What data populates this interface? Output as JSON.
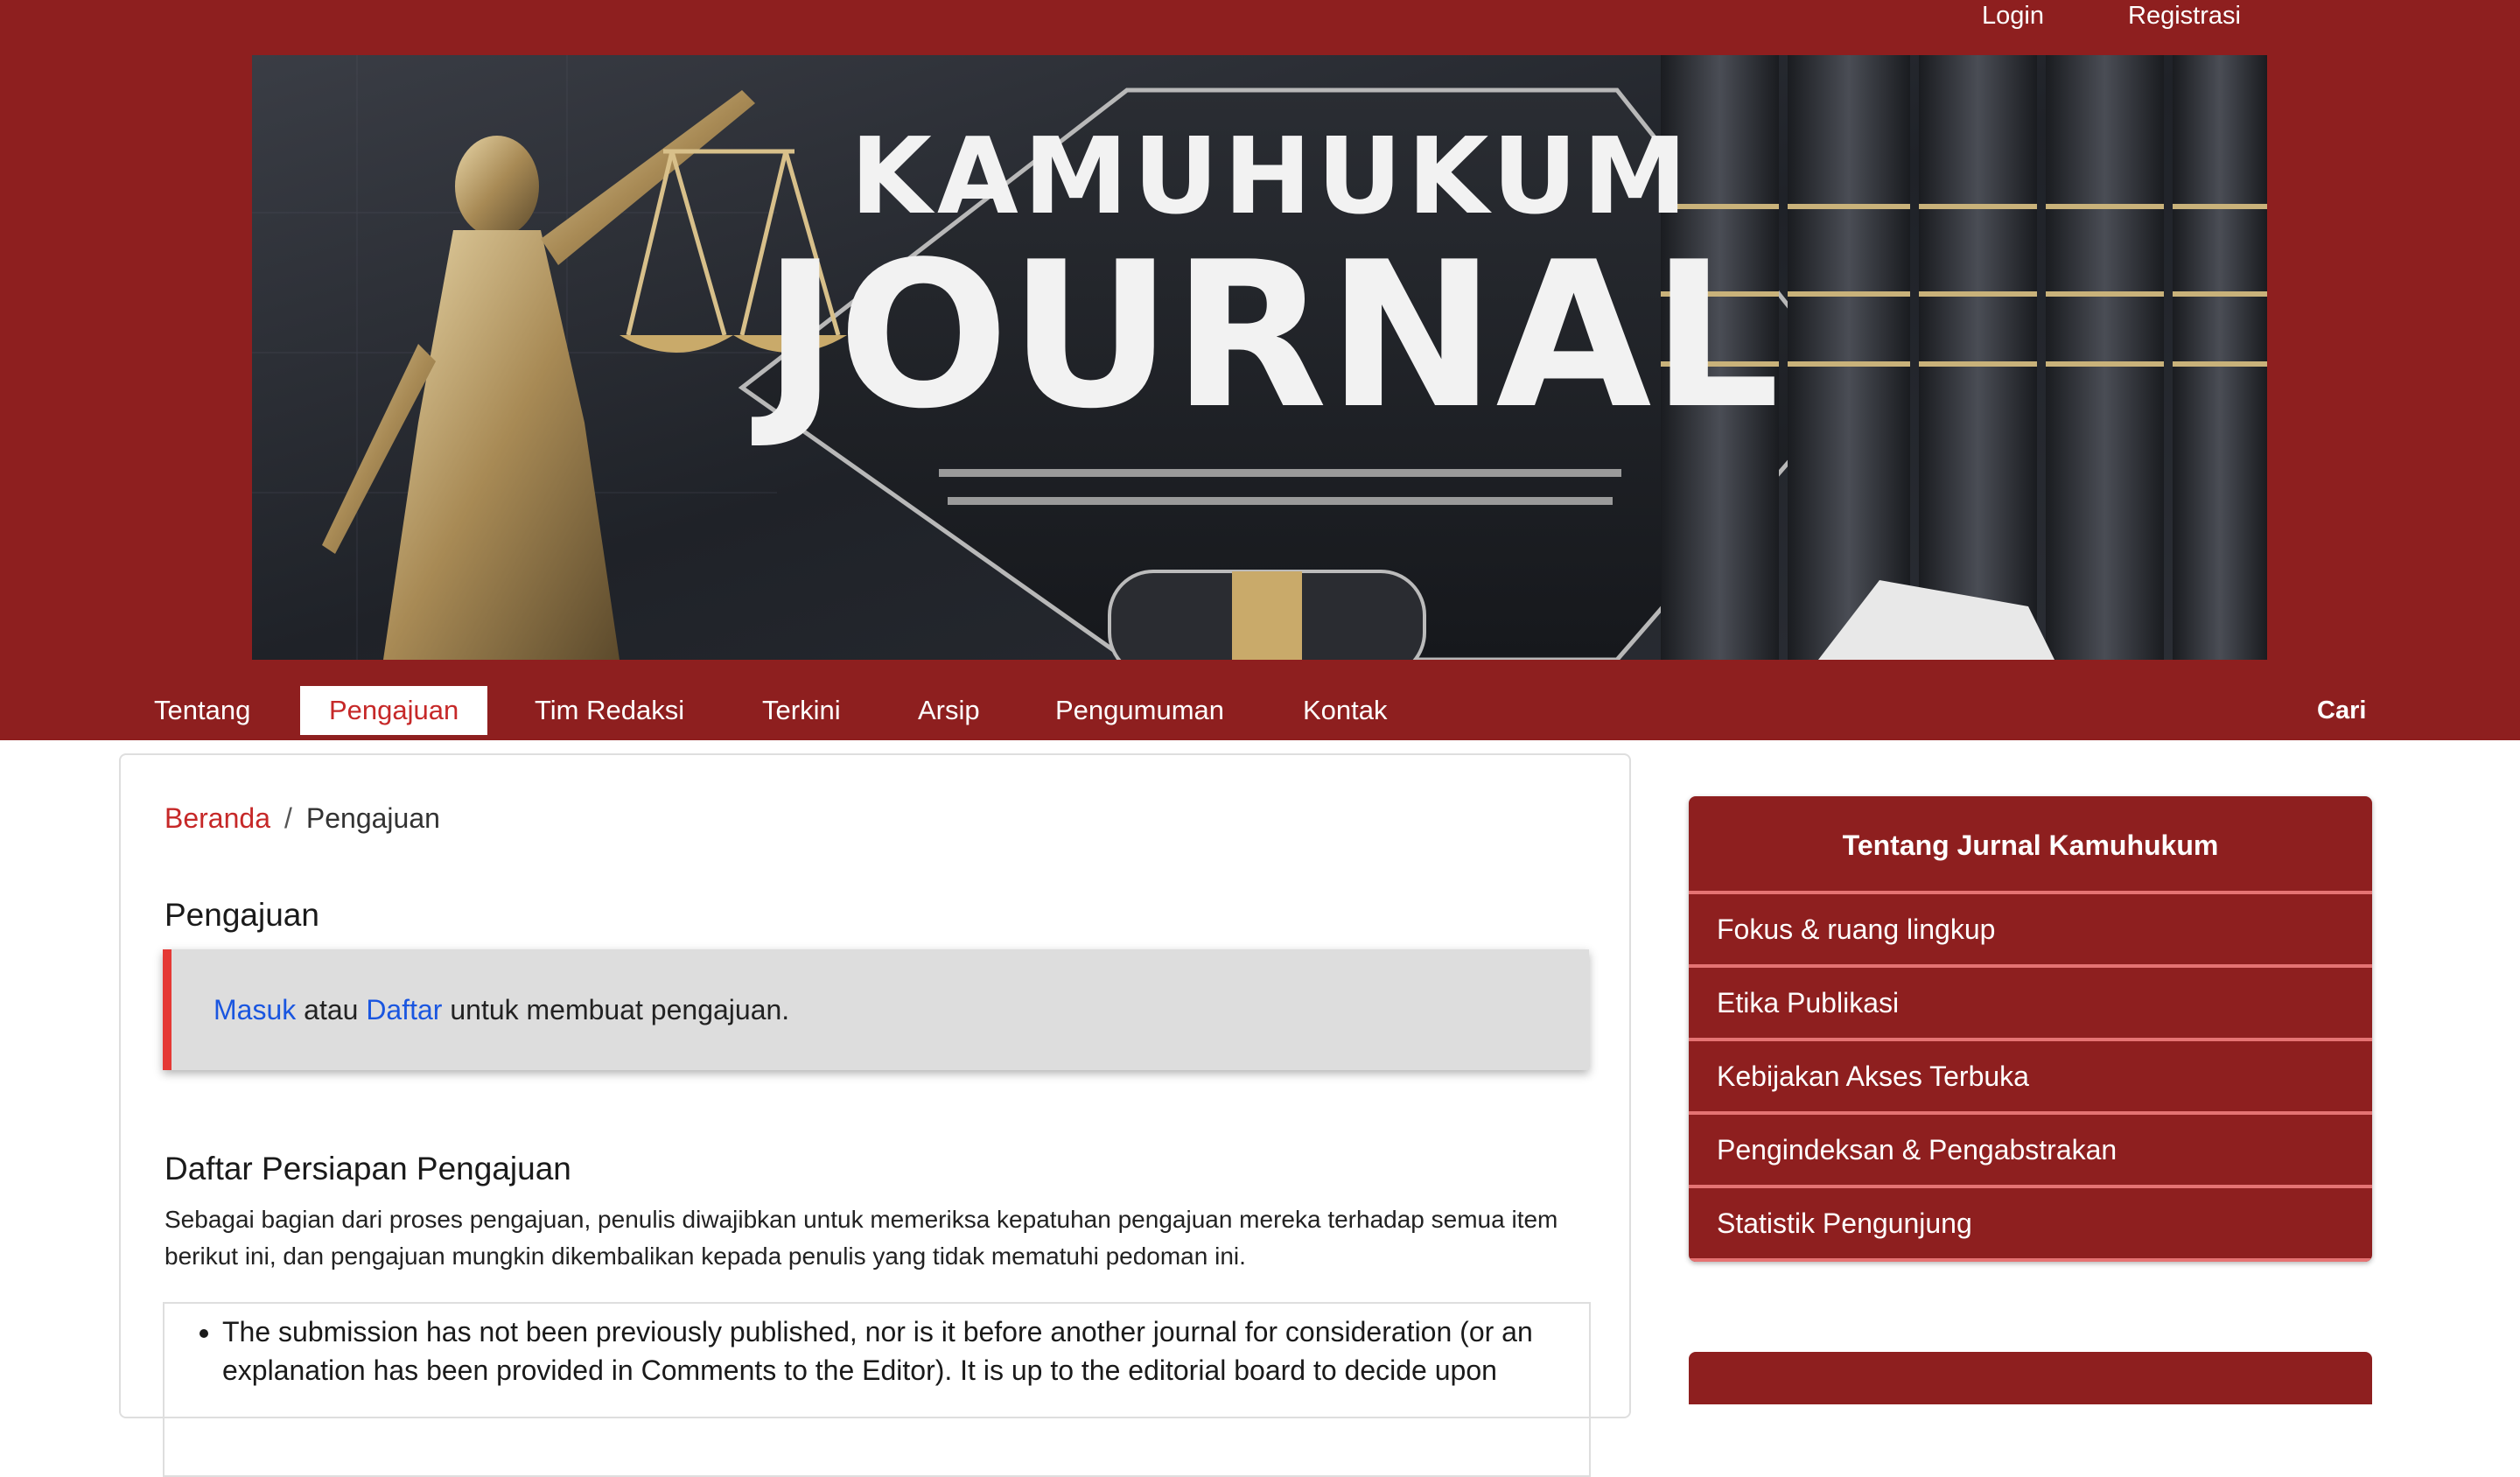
{
  "user_nav": {
    "login": "Login",
    "register": "Registrasi"
  },
  "banner": {
    "line1": "KAMUHUKUM",
    "line2": "JOURNAL"
  },
  "primary_nav": {
    "items": [
      {
        "label": "Tentang",
        "active": false
      },
      {
        "label": "Pengajuan",
        "active": true
      },
      {
        "label": "Tim Redaksi",
        "active": false
      },
      {
        "label": "Terkini",
        "active": false
      },
      {
        "label": "Arsip",
        "active": false
      },
      {
        "label": "Pengumuman",
        "active": false
      },
      {
        "label": "Kontak",
        "active": false
      }
    ],
    "search": "Cari"
  },
  "breadcrumb": {
    "home": "Beranda",
    "separator": "/",
    "current": "Pengajuan"
  },
  "main": {
    "title": "Pengajuan",
    "notice": {
      "login_link": "Masuk",
      "or": "atau",
      "register_link": "Daftar",
      "suffix": "untuk membuat pengajuan."
    },
    "checklist_title": "Daftar Persiapan Pengajuan",
    "checklist_desc": "Sebagai bagian dari proses pengajuan, penulis diwajibkan untuk memeriksa kepatuhan pengajuan mereka terhadap semua item berikut ini, dan pengajuan mungkin dikembalikan kepada penulis yang tidak mematuhi pedoman ini.",
    "checklist_items": [
      "The submission has not been previously published, nor is it before another journal for consideration (or an explanation has been provided in Comments to the Editor). It is up to the editorial board to decide upon"
    ]
  },
  "sidebar": {
    "title": "Tentang Jurnal Kamuhukum",
    "links": [
      "Fokus & ruang lingkup",
      "Etika Publikasi",
      "Kebijakan Akses Terbuka",
      "Pengindeksan & Pengabstrakan",
      "Statistik Pengunjung"
    ]
  },
  "colors": {
    "brand": "#8e1f1f",
    "active_text": "#c62828",
    "link": "#1a56e0",
    "notice_border": "#e53935"
  }
}
